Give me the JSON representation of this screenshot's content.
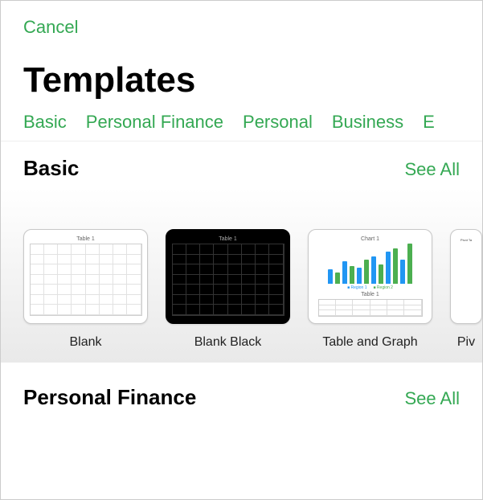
{
  "header": {
    "cancel": "Cancel",
    "title": "Templates"
  },
  "tabs": [
    "Basic",
    "Personal Finance",
    "Personal",
    "Business",
    "E"
  ],
  "sections": [
    {
      "title": "Basic",
      "seeAll": "See All",
      "items": [
        {
          "label": "Blank",
          "thumbLabel": "Table 1"
        },
        {
          "label": "Blank Black",
          "thumbLabel": "Table 1"
        },
        {
          "label": "Table and Graph",
          "thumbLabelTop": "Chart 1",
          "thumbLabelBottom": "Table 1",
          "legend": [
            "Region 1",
            "Region 2"
          ]
        },
        {
          "label": "Piv",
          "thumbLabel": "Pivot Ta"
        }
      ]
    },
    {
      "title": "Personal Finance",
      "seeAll": "See All"
    }
  ],
  "colors": {
    "accent": "#34a853"
  }
}
